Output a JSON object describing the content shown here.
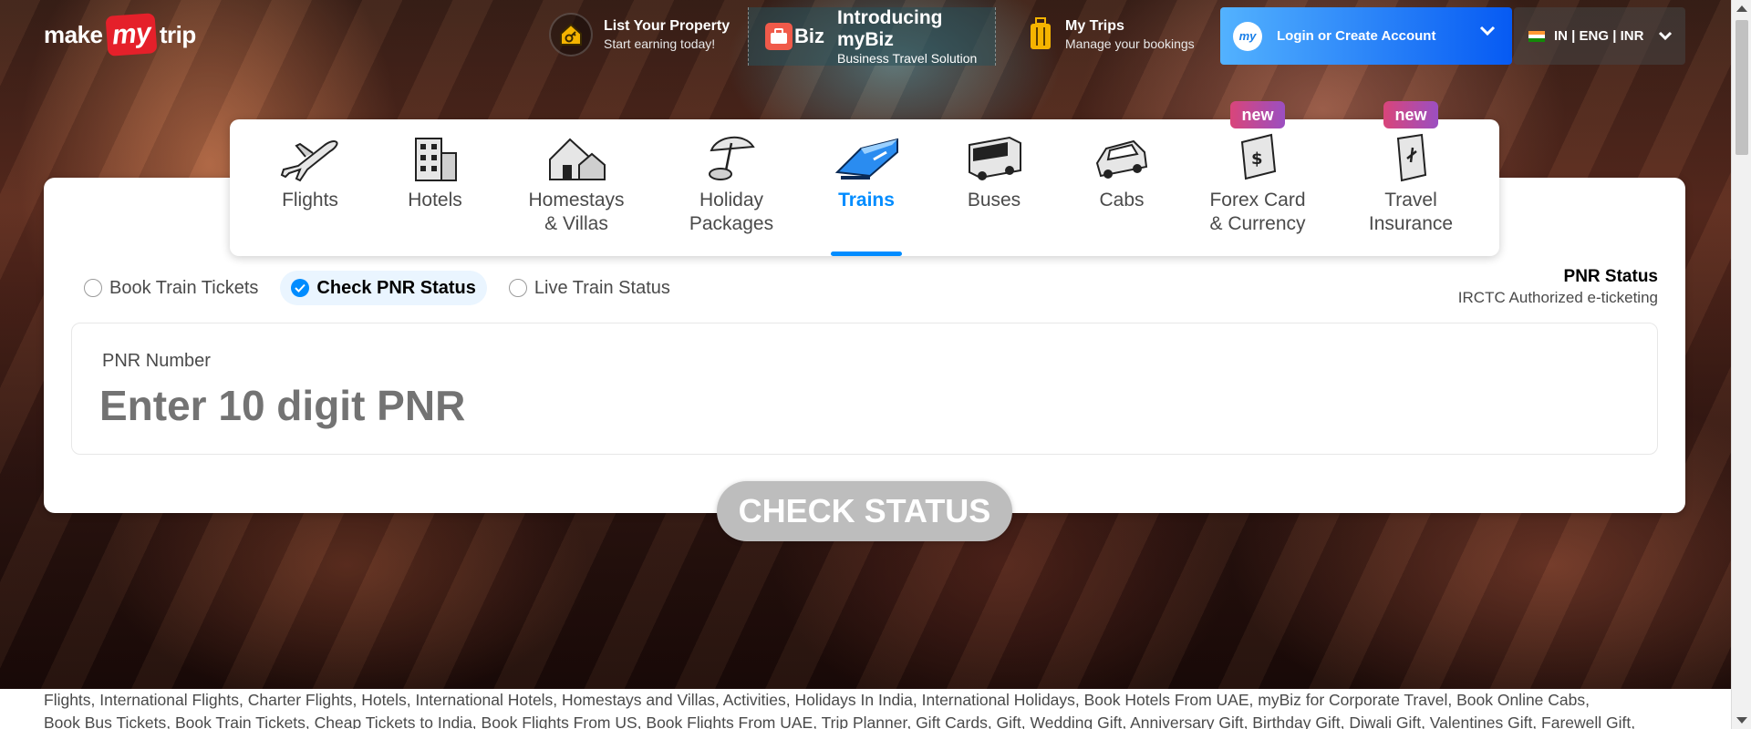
{
  "header": {
    "logo": {
      "pre": "make",
      "mid": "my",
      "post": "trip"
    },
    "list_property": {
      "title": "List Your Property",
      "subtitle": "Start earning today!"
    },
    "mybiz": {
      "badge": "Biz",
      "title": "Introducing myBiz",
      "subtitle": "Business Travel Solution"
    },
    "my_trips": {
      "title": "My Trips",
      "subtitle": "Manage your bookings"
    },
    "login": {
      "badge": "my",
      "label": "Login or Create Account"
    },
    "locale": {
      "label": "IN | ENG | INR"
    }
  },
  "nav": {
    "items": [
      {
        "label1": "Flights",
        "label2": "",
        "icon": "airplane-icon"
      },
      {
        "label1": "Hotels",
        "label2": "",
        "icon": "building-icon"
      },
      {
        "label1": "Homestays",
        "label2": "& Villas",
        "icon": "house-icon"
      },
      {
        "label1": "Holiday",
        "label2": "Packages",
        "icon": "umbrella-icon"
      },
      {
        "label1": "Trains",
        "label2": "",
        "icon": "train-icon",
        "active": true
      },
      {
        "label1": "Buses",
        "label2": "",
        "icon": "bus-icon"
      },
      {
        "label1": "Cabs",
        "label2": "",
        "icon": "car-icon"
      },
      {
        "label1": "Forex Card",
        "label2": "& Currency",
        "icon": "forex-card-icon",
        "tag": "new"
      },
      {
        "label1": "Travel",
        "label2": "Insurance",
        "icon": "insurance-icon",
        "tag": "new"
      }
    ]
  },
  "train_options": {
    "book": "Book Train Tickets",
    "pnr": "Check PNR Status",
    "live": "Live Train Status",
    "selected": "Check PNR Status"
  },
  "pnr_info": {
    "title": "PNR Status",
    "subtitle": "IRCTC Authorized e-ticketing"
  },
  "pnr_field": {
    "label": "PNR Number",
    "placeholder": "Enter 10 digit PNR",
    "value": ""
  },
  "check_button": "CHECK STATUS",
  "footer": {
    "line1": "Flights, International Flights, Charter Flights, Hotels, International Hotels, Homestays and Villas, Activities, Holidays In India, International Holidays, Book Hotels From UAE, myBiz for Corporate Travel, Book Online Cabs,",
    "line2": "Book Bus Tickets, Book Train Tickets, Cheap Tickets to India, Book Flights From US, Book Flights From UAE, Trip Planner, Gift Cards, Gift, Wedding Gift, Anniversary Gift, Birthday Gift, Diwali Gift, Valentines Gift, Farewell Gift,"
  },
  "colors": {
    "accent": "#008cff",
    "login_gradient_start": "#53b2fe",
    "login_gradient_end": "#065af3",
    "new_tag_start": "#d9457a",
    "new_tag_end": "#9b4fc1",
    "button_disabled": "#bdbdbd",
    "logo_red": "#e5202a"
  }
}
